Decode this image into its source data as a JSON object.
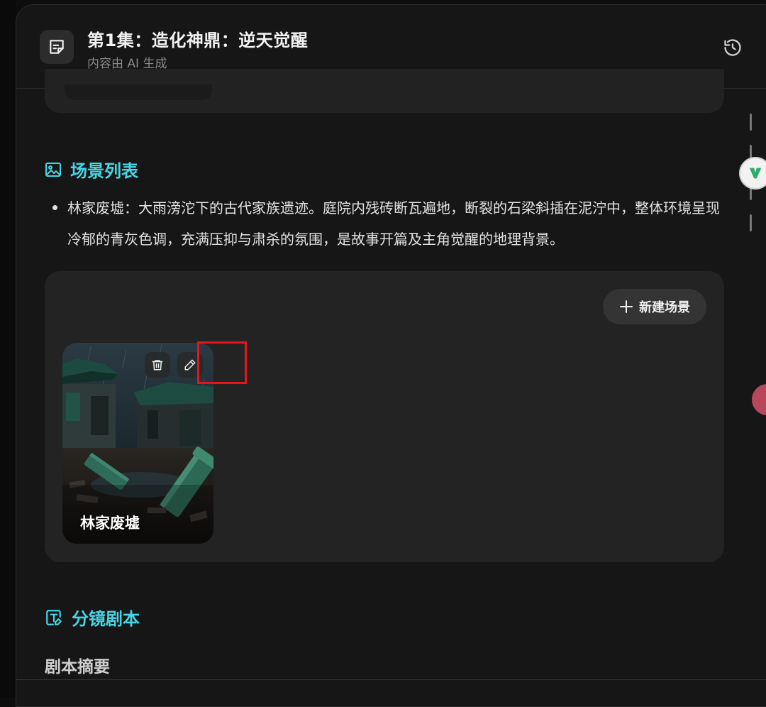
{
  "header": {
    "title": "第1集：造化神鼎：逆天觉醒",
    "subtitle": "内容由 AI 生成"
  },
  "scene_section": {
    "heading": "场景列表",
    "bullets": [
      "林家废墟：大雨滂沱下的古代家族遗迹。庭院内残砖断瓦遍地，断裂的石梁斜插在泥泞中，整体环境呈现冷郁的青灰色调，充满压抑与肃杀的氛围，是故事开篇及主角觉醒的地理背景。"
    ],
    "new_scene_label": "新建场景",
    "scenes": [
      {
        "name": "林家废墟"
      }
    ]
  },
  "storyboard_section": {
    "heading": "分镜剧本",
    "summary_heading": "剧本摘要"
  },
  "colors": {
    "accent": "#45d6e6",
    "highlight": "#e8141c"
  }
}
